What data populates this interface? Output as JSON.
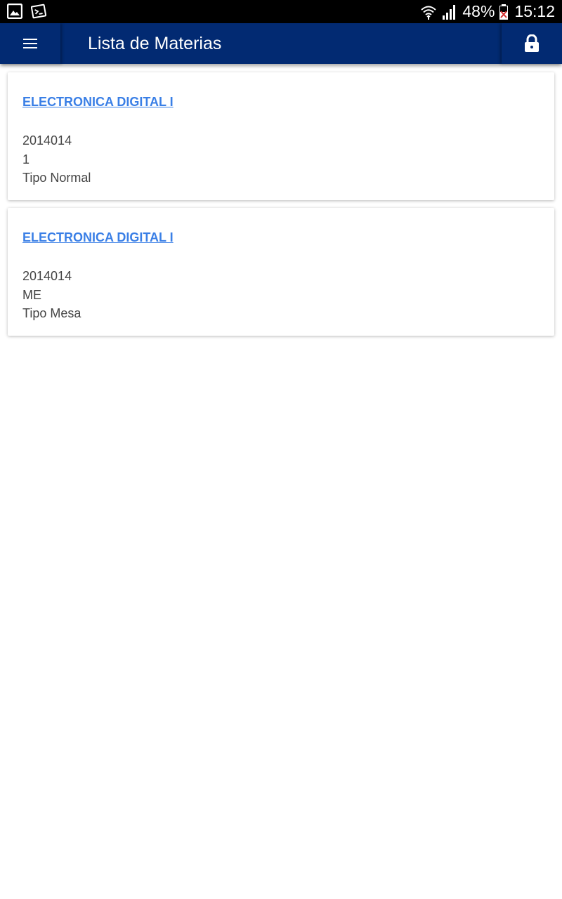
{
  "status_bar": {
    "battery": "48%",
    "time": "15:12",
    "left_icons": [
      "gallery-icon",
      "terminal-icon"
    ],
    "right_icons": [
      "wifi-icon",
      "signal-icon",
      "battery-icon"
    ]
  },
  "app_bar": {
    "title": "Lista de Materias",
    "menu_icon": "hamburger-menu-icon",
    "action_icon": "lock-icon",
    "background": "#022a72"
  },
  "materias": [
    {
      "title": "ELECTRONICA DIGITAL I",
      "code": "2014014",
      "group": "1",
      "type": "Tipo Normal"
    },
    {
      "title": "ELECTRONICA DIGITAL I",
      "code": "2014014",
      "group": "ME",
      "type": "Tipo Mesa"
    }
  ],
  "colors": {
    "link": "#3a7fe6",
    "text": "#444444"
  }
}
